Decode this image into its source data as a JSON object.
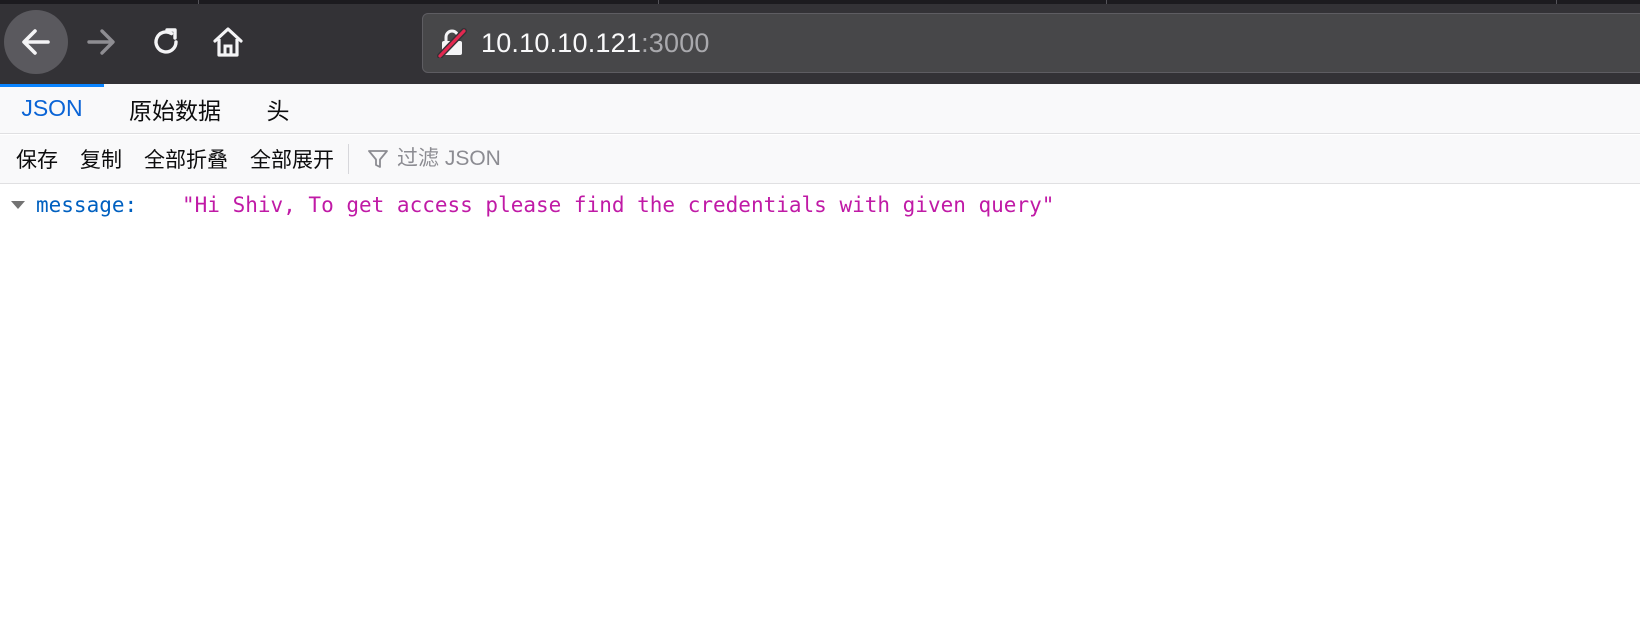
{
  "browser": {
    "url_host": "10.10.10.121",
    "url_port": ":3000"
  },
  "viewer_tabs": [
    {
      "label": "JSON",
      "active": true
    },
    {
      "label": "原始数据",
      "active": false
    },
    {
      "label": "头",
      "active": false
    }
  ],
  "toolbar": {
    "save_label": "保存",
    "copy_label": "复制",
    "collapse_all_label": "全部折叠",
    "expand_all_label": "全部展开",
    "filter_placeholder": "过滤 JSON"
  },
  "json_tree": {
    "rows": [
      {
        "key": "message:",
        "value": "\"Hi Shiv, To get access please find the credentials with given query\""
      }
    ]
  },
  "colors": {
    "chrome_bg": "#333236",
    "active_tab_text": "#0a64d6",
    "json_key": "#0060c0",
    "json_string": "#c01aa6"
  },
  "icons": [
    "back-arrow-icon",
    "forward-arrow-icon",
    "reload-icon",
    "home-icon",
    "insecure-lock-icon",
    "filter-icon",
    "collapse-twisty-icon"
  ]
}
